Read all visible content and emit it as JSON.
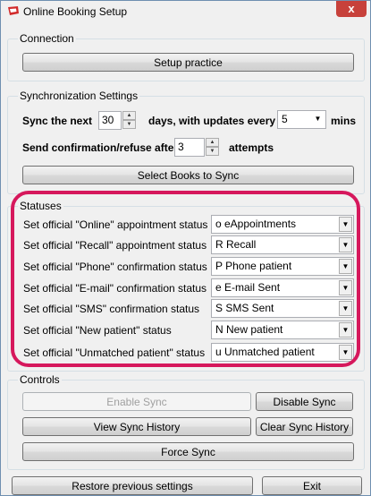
{
  "window": {
    "title": "Online Booking Setup",
    "close_symbol": "x"
  },
  "connection": {
    "label": "Connection",
    "setup_button": "Setup practice"
  },
  "sync": {
    "label": "Synchronization Settings",
    "sync_next_label": "Sync the next",
    "sync_next_value": "30",
    "days_label": "days, with updates every",
    "interval_value": "5",
    "mins_label": "mins",
    "send_after_label": "Send confirmation/refuse after",
    "attempts_value": "3",
    "attempts_label": "attempts",
    "select_books_button": "Select Books to Sync"
  },
  "statuses": {
    "label": "Statuses",
    "rows": [
      {
        "label": "Set official \"Online\" appointment status",
        "value": "o eAppointments"
      },
      {
        "label": "Set official \"Recall\" appointment status",
        "value": "R Recall"
      },
      {
        "label": "Set official \"Phone\" confirmation status",
        "value": "P Phone patient"
      },
      {
        "label": "Set official \"E-mail\" confirmation status",
        "value": "e E-mail Sent"
      },
      {
        "label": "Set official \"SMS\" confirmation status",
        "value": "S SMS Sent"
      },
      {
        "label": "Set official \"New patient\" status",
        "value": "N New patient"
      },
      {
        "label": "Set official \"Unmatched patient\" status",
        "value": "u Unmatched patient"
      }
    ]
  },
  "controls": {
    "label": "Controls",
    "enable_sync": "Enable Sync",
    "disable_sync": "Disable Sync",
    "view_history": "View Sync History",
    "clear_history": "Clear Sync History",
    "force_sync": "Force Sync"
  },
  "footer": {
    "restore_button": "Restore previous settings",
    "exit_button": "Exit"
  },
  "colors": {
    "highlight": "#d6185c",
    "close_button": "#c7413b"
  }
}
